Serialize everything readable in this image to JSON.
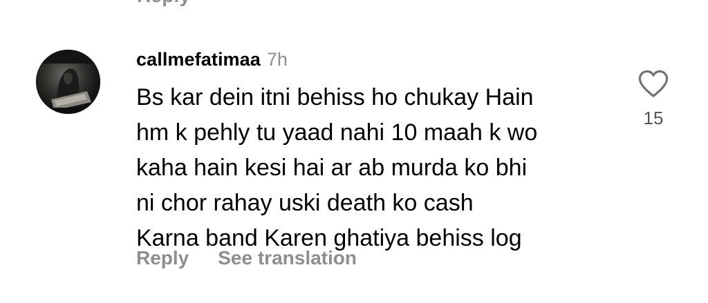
{
  "previous_comment": {
    "reply_label": "Reply"
  },
  "comment": {
    "username": "callmefatimaa",
    "timestamp": "7h",
    "lines": [
      "Bs kar dein itni behiss ho chukay Hain",
      "hm k pehly tu yaad nahi 10 maah k wo",
      "kaha hain kesi hai ar ab murda ko bhi",
      "ni chor rahay uski death ko cash",
      "Karna band Karen ghatiya behiss log"
    ],
    "like_count": "15",
    "like_icon": "heart-outline-icon",
    "actions": {
      "reply_label": "Reply",
      "translate_label": "See translation"
    }
  },
  "colors": {
    "text_primary": "#000000",
    "text_secondary": "#8e8e8e",
    "background": "#ffffff"
  }
}
